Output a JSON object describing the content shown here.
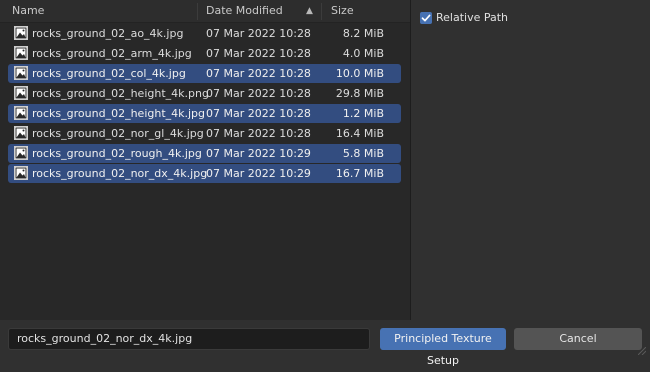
{
  "columns": {
    "name": "Name",
    "date": "Date Modified",
    "size": "Size"
  },
  "files": [
    {
      "name": "rocks_ground_02_ao_4k.jpg",
      "date": "07 Mar 2022 10:28",
      "size": "8.2 MiB",
      "selected": false
    },
    {
      "name": "rocks_ground_02_arm_4k.jpg",
      "date": "07 Mar 2022 10:28",
      "size": "4.0 MiB",
      "selected": false
    },
    {
      "name": "rocks_ground_02_col_4k.jpg",
      "date": "07 Mar 2022 10:28",
      "size": "10.0 MiB",
      "selected": true
    },
    {
      "name": "rocks_ground_02_height_4k.png",
      "date": "07 Mar 2022 10:28",
      "size": "29.8 MiB",
      "selected": false
    },
    {
      "name": "rocks_ground_02_height_4k.jpg",
      "date": "07 Mar 2022 10:28",
      "size": "1.2 MiB",
      "selected": true
    },
    {
      "name": "rocks_ground_02_nor_gl_4k.jpg",
      "date": "07 Mar 2022 10:28",
      "size": "16.4 MiB",
      "selected": false
    },
    {
      "name": "rocks_ground_02_rough_4k.jpg",
      "date": "07 Mar 2022 10:29",
      "size": "5.8 MiB",
      "selected": true
    },
    {
      "name": "rocks_ground_02_nor_dx_4k.jpg",
      "date": "07 Mar 2022 10:29",
      "size": "16.7 MiB",
      "selected": true
    }
  ],
  "options": {
    "relative_path_label": "Relative Path",
    "relative_path_checked": true
  },
  "footer": {
    "filename_value": "rocks_ground_02_nor_dx_4k.jpg",
    "confirm_label": "Principled Texture Setup",
    "cancel_label": "Cancel"
  },
  "colors": {
    "selection": "#334d80",
    "accent": "#4772b3"
  },
  "icons": {
    "file": "image-file-icon",
    "sort": "sort-ascending-icon",
    "check": "checkmark-icon"
  }
}
